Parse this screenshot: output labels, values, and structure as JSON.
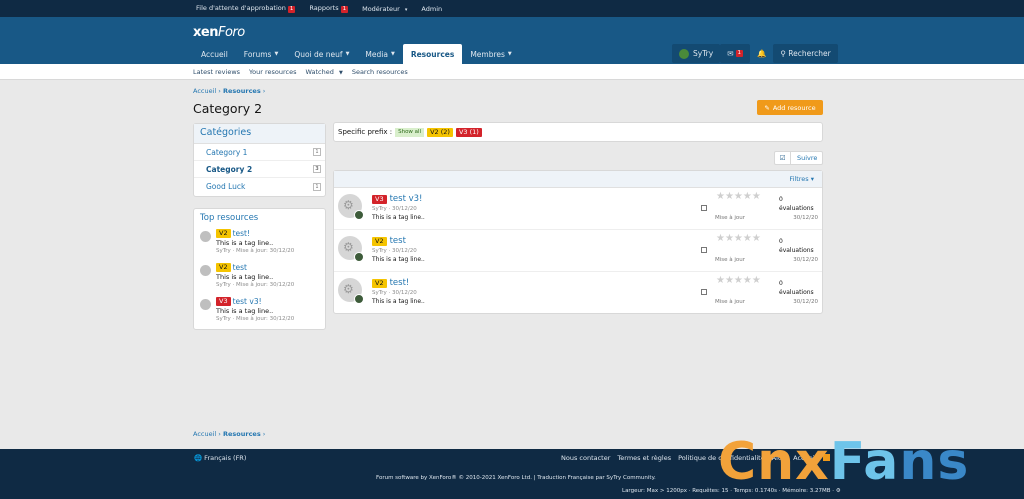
{
  "topbar": {
    "items": [
      {
        "label": "File d'attente d'approbation",
        "badge": "1"
      },
      {
        "label": "Rapports",
        "badge": "1"
      },
      {
        "label": "Modérateur",
        "caret": "▾"
      },
      {
        "label": "Admin"
      }
    ]
  },
  "logo": {
    "main": "xen",
    "accent": "Foro"
  },
  "nav": {
    "items": [
      "Accueil",
      "Forums",
      "Quoi de neuf",
      "Media",
      "Resources",
      "Membres"
    ],
    "active": "Resources",
    "user": "SyTry",
    "inbox_badge": "1",
    "search_label": "Rechercher"
  },
  "subnav": {
    "items": [
      "Latest reviews",
      "Your resources",
      "Watched",
      "Search resources"
    ]
  },
  "breadcrumb": {
    "home": "Accueil",
    "current": "Resources",
    "sep": "›"
  },
  "page_title": "Category 2",
  "add_resource_label": "Add resource",
  "categories": {
    "title": "Catégories",
    "items": [
      {
        "label": "Category 1",
        "count": "1"
      },
      {
        "label": "Category 2",
        "count": "3",
        "active": true
      },
      {
        "label": "Good Luck",
        "count": "1"
      }
    ]
  },
  "top_resources": {
    "title": "Top resources",
    "items": [
      {
        "prefix": "V2",
        "title": "test!",
        "tagline": "This is a tag line..",
        "meta": "SyTry · Mise à jour: 30/12/20"
      },
      {
        "prefix": "V2",
        "title": "test",
        "tagline": "This is a tag line..",
        "meta": "SyTry · Mise à jour: 30/12/20"
      },
      {
        "prefix": "V3",
        "title": "test v3!",
        "tagline": "This is a tag line..",
        "meta": "SyTry · Mise à jour: 30/12/20"
      }
    ]
  },
  "prefix_filter": {
    "label": "Specific prefix :",
    "show_all": "Show all",
    "v2": "V2 (2)",
    "v3": "V3 (1)"
  },
  "follow_label": "Suivre",
  "filters_label": "Filtres ▾",
  "resources": [
    {
      "prefix": "V3",
      "title": "test v3!",
      "meta": "SyTry · 30/12/20",
      "tagline": "This is a tag line..",
      "updated": "Mise à jour",
      "count": "0",
      "count_label": "évaluations",
      "date": "30/12/20"
    },
    {
      "prefix": "V2",
      "title": "test",
      "meta": "SyTry · 30/12/20",
      "tagline": "This is a tag line..",
      "updated": "Mise à jour",
      "count": "0",
      "count_label": "évaluations",
      "date": "30/12/20"
    },
    {
      "prefix": "V2",
      "title": "test!",
      "meta": "SyTry · 30/12/20",
      "tagline": "This is a tag line..",
      "updated": "Mise à jour",
      "count": "0",
      "count_label": "évaluations",
      "date": "30/12/20"
    }
  ],
  "footer": {
    "language": "Français (FR)",
    "links": [
      "Nous contacter",
      "Termes et règles",
      "Politique de confidentialité",
      "Aide",
      "Accueil"
    ],
    "copyright": "Forum software by XenForo® © 2010-2021 XenForo Ltd. | Traduction Française par SyTry Community.",
    "stats": "Largeur: Max > 1200px · Requêtes: 15 · Temps: 0.1740s · Mémoire: 3.27MB · ⚙"
  },
  "watermark": {
    "a": "Cnx",
    "b": "Fa",
    "c": "ns"
  },
  "colors": {
    "brand": "#185886",
    "topbar": "#0f2a44",
    "accent": "#f09a1a",
    "v2": "#f5c400",
    "v3": "#d3232a"
  }
}
